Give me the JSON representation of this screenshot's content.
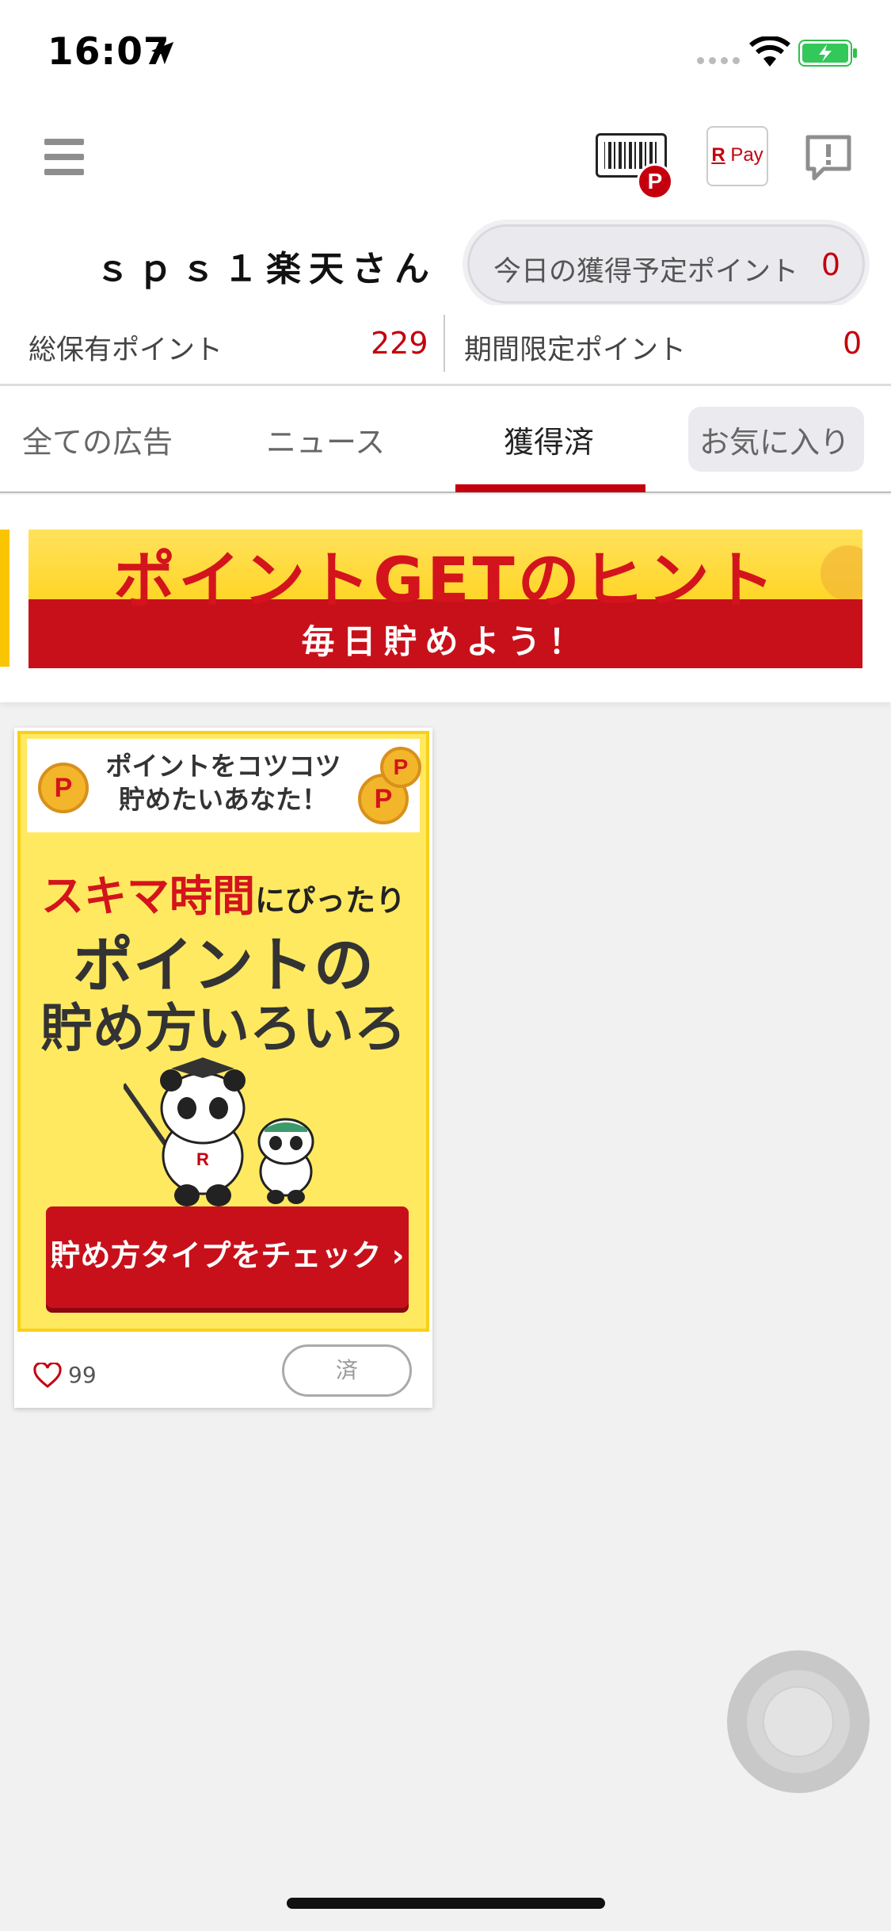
{
  "status_bar": {
    "time": "16:07"
  },
  "header": {
    "barcode_badge": "P",
    "rpay_r": "R",
    "rpay_pay": "Pay"
  },
  "user": {
    "name": "ｓｐｓ１楽天さん",
    "today_points_label": "今日の獲得予定ポイント",
    "today_points_value": "0"
  },
  "points": {
    "total_label": "総保有ポイント",
    "total_value": "229",
    "limited_label": "期間限定ポイント",
    "limited_value": "0"
  },
  "tabs": [
    {
      "label": "全ての広告"
    },
    {
      "label": "ニュース"
    },
    {
      "label": "獲得済"
    },
    {
      "label": "お気に入り"
    }
  ],
  "banner": {
    "title": "ポイントGETのヒント",
    "subtitle": "毎日貯めよう！"
  },
  "ad": {
    "top_line1": "ポイントをコツコツ",
    "top_line2": "貯めたいあなた！",
    "coin_letter": "P",
    "line1_red": "スキマ時間",
    "line1_rest": "にぴったり",
    "line2": "ポイントの",
    "line3": "貯め方いろいろ",
    "cta": "貯め方タイプをチェック ›",
    "like_count": "99",
    "done_label": "済"
  },
  "colors": {
    "accent": "#c4000e",
    "banner_yellow": "#ffd21a"
  }
}
